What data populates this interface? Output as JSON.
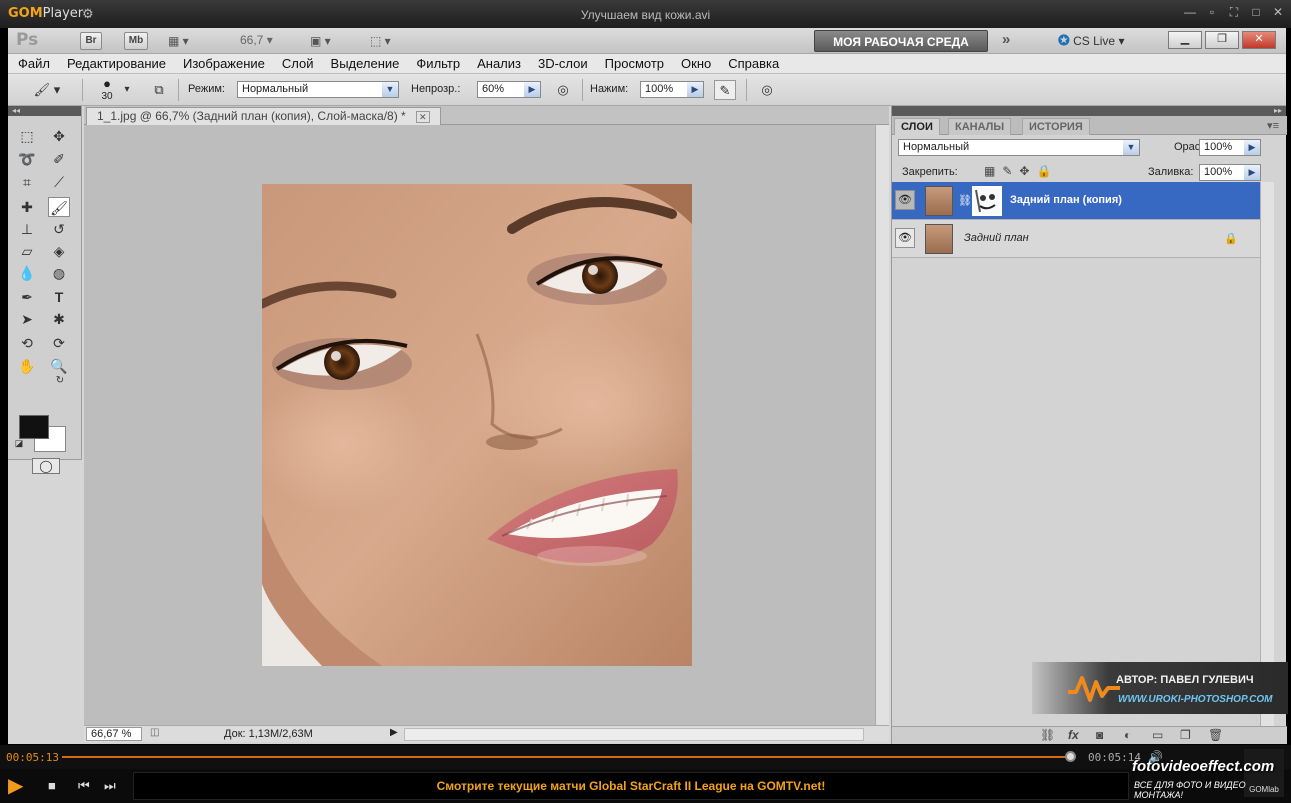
{
  "gom": {
    "logo_brand": "GOM",
    "logo_suffix": "Player",
    "file_title": "Улучшаем вид кожи.avi",
    "time_elapsed": "00:05:13",
    "time_total": "00:05:14",
    "ticker": "Смотрите текущие матчи Global StarCraft II League на GOMTV.net!",
    "gomlab": "GOMlab",
    "seek_progress": 0.997
  },
  "appbar": {
    "ps_logo": "Ps",
    "br": "Br",
    "mb": "Mb",
    "zoom": "66,7",
    "workspace": "МОЯ РАБОЧАЯ СРЕДА",
    "cslive": "CS Live"
  },
  "menu": [
    "Файл",
    "Редактирование",
    "Изображение",
    "Слой",
    "Выделение",
    "Фильтр",
    "Анализ",
    "3D-слои",
    "Просмотр",
    "Окно",
    "Справка"
  ],
  "options": {
    "brush_size": "30",
    "mode_label": "Режим:",
    "mode_value": "Нормальный",
    "opacity_label": "Непрозр.:",
    "opacity_value": "60%",
    "flow_label": "Нажим:",
    "flow_value": "100%"
  },
  "document": {
    "tab_title": "1_1.jpg @ 66,7% (Задний план (копия), Слой-маска/8) *",
    "zoom": "66,67 %",
    "doc_info": "Док: 1,13M/2,63M"
  },
  "layers_panel": {
    "tabs": [
      "СЛОИ",
      "КАНАЛЫ",
      "ИСТОРИЯ"
    ],
    "blend_mode": "Нормальный",
    "opacity_label": "Opacity:",
    "opacity_value": "100%",
    "lock_label": "Закрепить:",
    "fill_label": "Заливка:",
    "fill_value": "100%",
    "layers": [
      {
        "name": "Задний план (копия)"
      },
      {
        "name": "Задний план"
      }
    ]
  },
  "watermark": {
    "author": "АВТОР: ПАВЕЛ ГУЛЕВИЧ",
    "site": "WWW.UROKI-PHOTOSHOP.COM"
  },
  "brand": {
    "name": "fotovideoeffect.com",
    "tagline": "ВСЕ ДЛЯ ФОТО И ВИДЕО МОНТАЖА!"
  }
}
